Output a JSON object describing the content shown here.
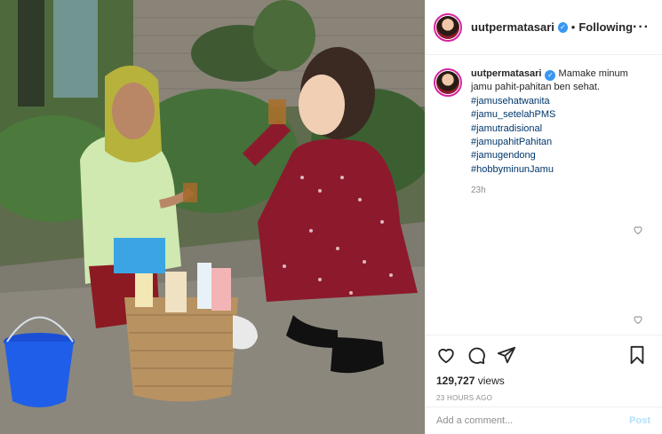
{
  "post": {
    "username": "uutpermatasari",
    "verified": true,
    "separator": "•",
    "follow_status": "Following",
    "more_icon": "more-horizontal-icon"
  },
  "caption": {
    "username": "uutpermatasari",
    "text": "Mamake minum jamu pahit-pahitan ben sehat.",
    "hashtags": [
      "#jamusehatwanita",
      "#jamu_setelahPMS",
      "#jamutradisional",
      "#jamupahitPahitan",
      "#jamugendong",
      "#hobbyminunJamu"
    ],
    "time": "23h"
  },
  "actions": {
    "icons": [
      "heart-icon",
      "comment-icon",
      "share-icon",
      "bookmark-icon"
    ]
  },
  "stats": {
    "views_count": "129,727",
    "views_label": "views",
    "posted": "23 HOURS AGO"
  },
  "comment_box": {
    "placeholder": "Add a comment...",
    "post_label": "Post"
  },
  "colors": {
    "link": "#00376b",
    "verified": "#3897f0",
    "post_disabled": "#b2dffc",
    "muted": "#8e8e8e"
  }
}
